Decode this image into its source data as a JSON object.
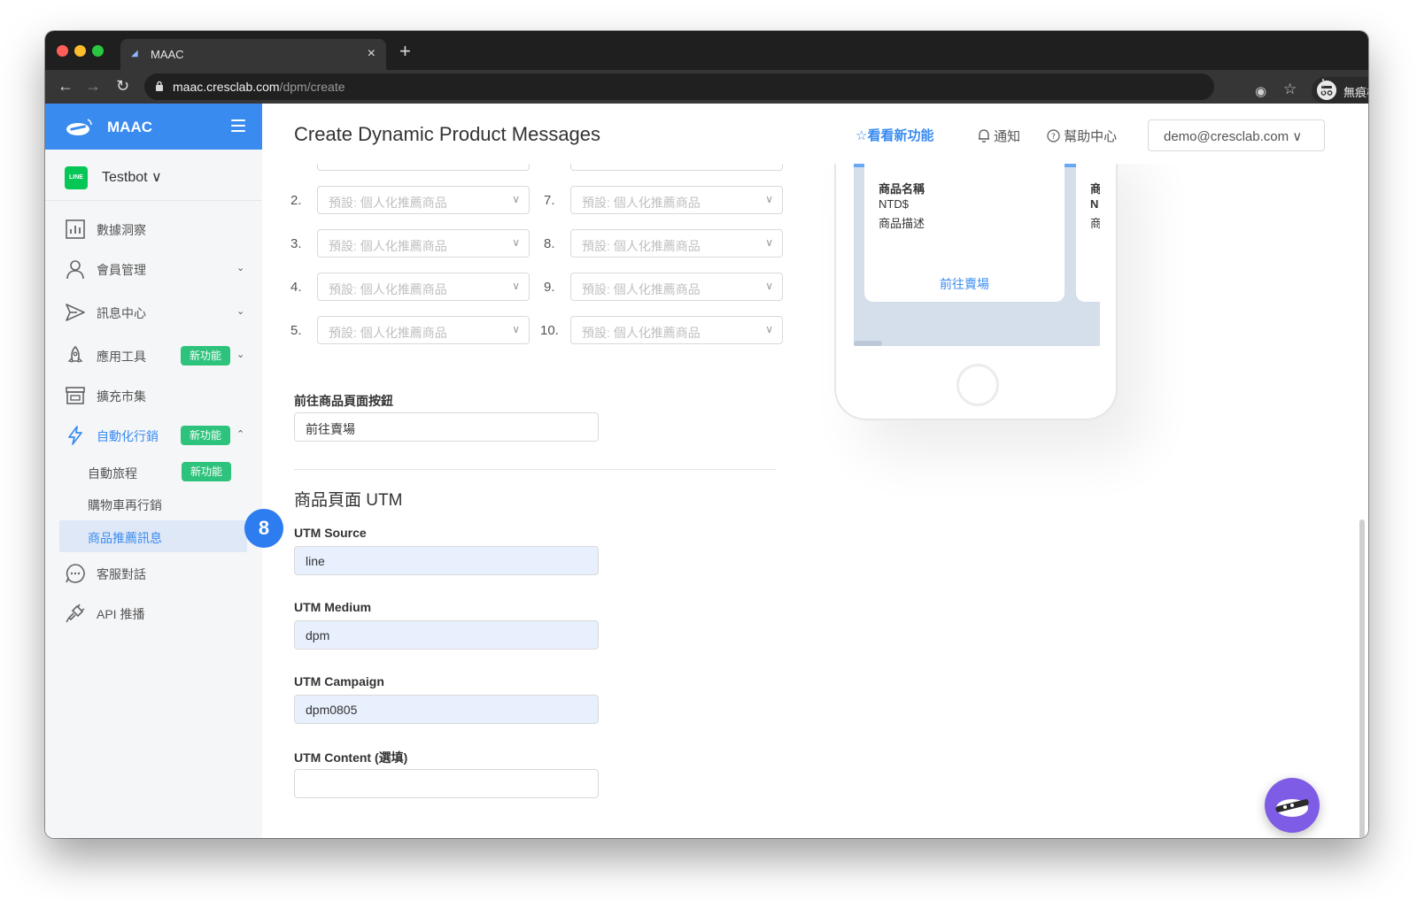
{
  "browser": {
    "tab_title": "MAAC",
    "tab_close": "×",
    "new_tab": "+",
    "url_host": "maac.cresclab.com",
    "url_path": "/dpm/create",
    "incognito_label": "無痕模式"
  },
  "sidebar": {
    "logo_text": "MAAC",
    "account_badge": "LINE",
    "account_name": "Testbot ∨",
    "items": [
      {
        "label": "數據洞察",
        "icon": "chart-icon"
      },
      {
        "label": "會員管理",
        "icon": "user-icon",
        "chevron": "⌄"
      },
      {
        "label": "訊息中心",
        "icon": "send-icon",
        "chevron": "⌄"
      },
      {
        "label": "應用工具",
        "icon": "rocket-icon",
        "badge": "新功能",
        "chevron": "⌄"
      },
      {
        "label": "擴充市集",
        "icon": "store-icon"
      },
      {
        "label": "自動化行銷",
        "icon": "lightning-icon",
        "badge": "新功能",
        "chevron": "⌃"
      },
      {
        "label": "客服對話",
        "icon": "chat-icon"
      },
      {
        "label": "API 推播",
        "icon": "plug-icon"
      }
    ],
    "sub_items": [
      {
        "label": "自動旅程",
        "badge": "新功能"
      },
      {
        "label": "購物車再行銷"
      },
      {
        "label": "商品推薦訊息"
      }
    ]
  },
  "header": {
    "page_title": "Create Dynamic Product Messages",
    "whats_new": "看看新功能",
    "notify": "通知",
    "help": "幫助中心",
    "user_email": "demo@cresclab.com ∨"
  },
  "product_slots": {
    "placeholder": "預設: 個人化推薦商品",
    "left_numbers": [
      "2.",
      "3.",
      "4.",
      "5."
    ],
    "right_numbers": [
      "7.",
      "8.",
      "9.",
      "10."
    ]
  },
  "form": {
    "button_label": "前往商品頁面按鈕",
    "button_value": "前往賣場",
    "utm_section_title": "商品頁面 UTM",
    "step_number": "8",
    "utm_source_label": "UTM Source",
    "utm_source_value": "line",
    "utm_medium_label": "UTM Medium",
    "utm_medium_value": "dpm",
    "utm_campaign_label": "UTM Campaign",
    "utm_campaign_value": "dpm0805",
    "utm_content_label": "UTM Content (選填)",
    "utm_content_value": ""
  },
  "preview": {
    "card_name": "商品名稱",
    "card_price": "NTD$",
    "card_desc": "商品描述",
    "card_link": "前往賣場",
    "card2_lines": [
      "商",
      "N",
      "商"
    ]
  },
  "colors": {
    "accent": "#3a8bf0",
    "badge_green": "#2ec37c",
    "line_green": "#06c755",
    "step_blue": "#2d7cf0",
    "fab_purple": "#7e5ce6"
  }
}
